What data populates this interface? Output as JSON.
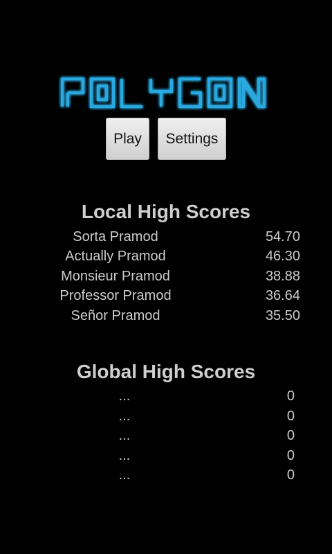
{
  "app": {
    "logo_text": "POLYGON",
    "logo_color": "#2aa8e0"
  },
  "menu": {
    "play_label": "Play",
    "settings_label": "Settings"
  },
  "local": {
    "title": "Local High Scores",
    "scores": [
      {
        "name": "Sorta Pramod",
        "score": "54.70"
      },
      {
        "name": "Actually Pramod",
        "score": "46.30"
      },
      {
        "name": "Monsieur Pramod",
        "score": "38.88"
      },
      {
        "name": "Professor Pramod",
        "score": "36.64"
      },
      {
        "name": "Señor Pramod",
        "score": "35.50"
      }
    ]
  },
  "global": {
    "title": "Global High Scores",
    "scores": [
      {
        "name": "...",
        "score": "0"
      },
      {
        "name": "...",
        "score": "0"
      },
      {
        "name": "...",
        "score": "0"
      },
      {
        "name": "...",
        "score": "0"
      },
      {
        "name": "...",
        "score": "0"
      }
    ]
  }
}
